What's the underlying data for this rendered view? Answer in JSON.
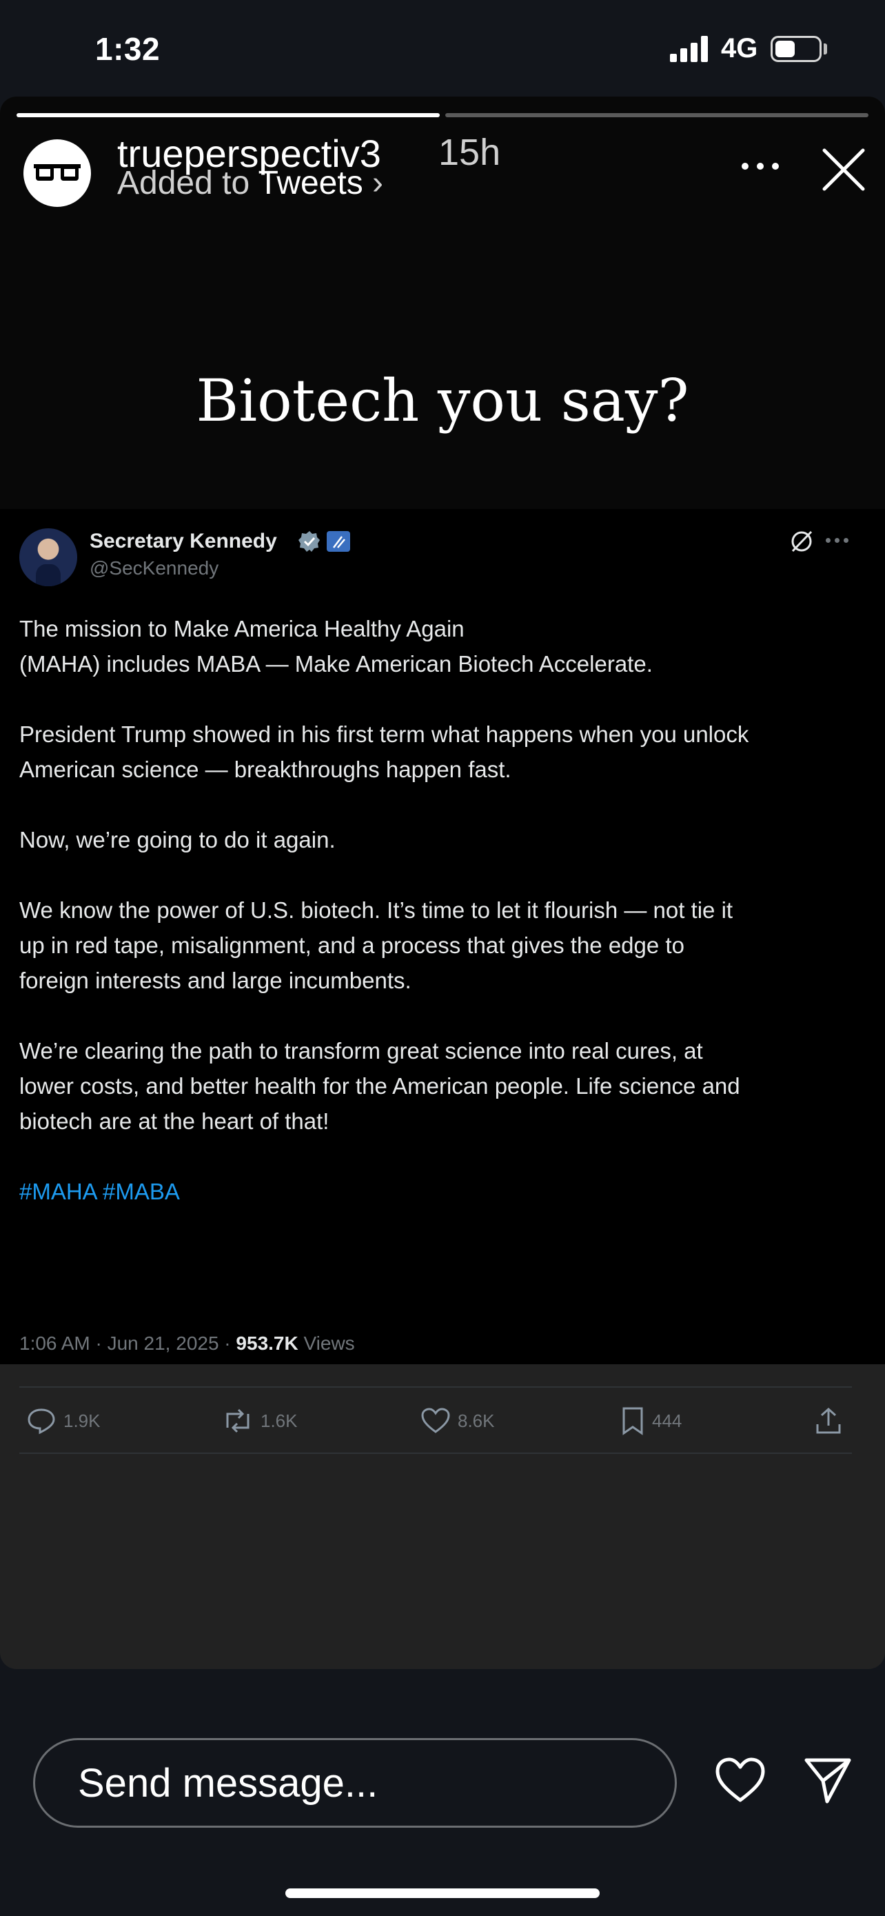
{
  "status_bar": {
    "time": "1:32",
    "network": "4G",
    "battery_level": 0.45
  },
  "story": {
    "progress": [
      1.0,
      0.0
    ],
    "username": "trueperspectiv3",
    "time_ago": "15h",
    "added_to_prefix": "Added to",
    "added_to_highlight": "Tweets",
    "added_to_chevron": "›",
    "caption": "Biotech you say?"
  },
  "tweet": {
    "display_name": "Secretary Kennedy",
    "handle": "@SecKennedy",
    "paragraphs": [
      "The mission to Make America Healthy Again\n(MAHA) includes MABA — Make American Biotech Accelerate.",
      "President Trump showed in his first term what happens when you unlock\nAmerican science — breakthroughs happen fast.",
      "Now, we’re going to do it again.",
      "We know the power of U.S. biotech. It’s time to let it flourish — not tie it\nup in red tape, misalignment, and a process that gives the edge to\nforeign interests and large incumbents.",
      "We’re clearing the path to transform great science into real cures, at\nlower costs, and better health for the American people. Life science and\nbiotech are at the heart of that!"
    ],
    "hashtags": "#MAHA #MABA",
    "timestamp": "1:06 AM · Jun 21, 2025 · ",
    "views_count": "953.7K",
    "views_label": " Views",
    "replies": "1.9K",
    "reposts": "1.6K",
    "likes": "8.6K",
    "bookmarks": "444"
  },
  "footer": {
    "message_placeholder": "Send message..."
  },
  "icons": [
    "glasses-icon",
    "more-icon",
    "close-icon",
    "verified-icon",
    "gov-badge-icon",
    "grok-icon",
    "reply-icon",
    "repost-icon",
    "like-icon",
    "bookmark-icon",
    "share-icon",
    "heart-icon",
    "send-icon"
  ],
  "colors": {
    "accent": "#1d9bf0",
    "verified": "#829aab",
    "muted": "#71767b",
    "background": "#12151b"
  }
}
